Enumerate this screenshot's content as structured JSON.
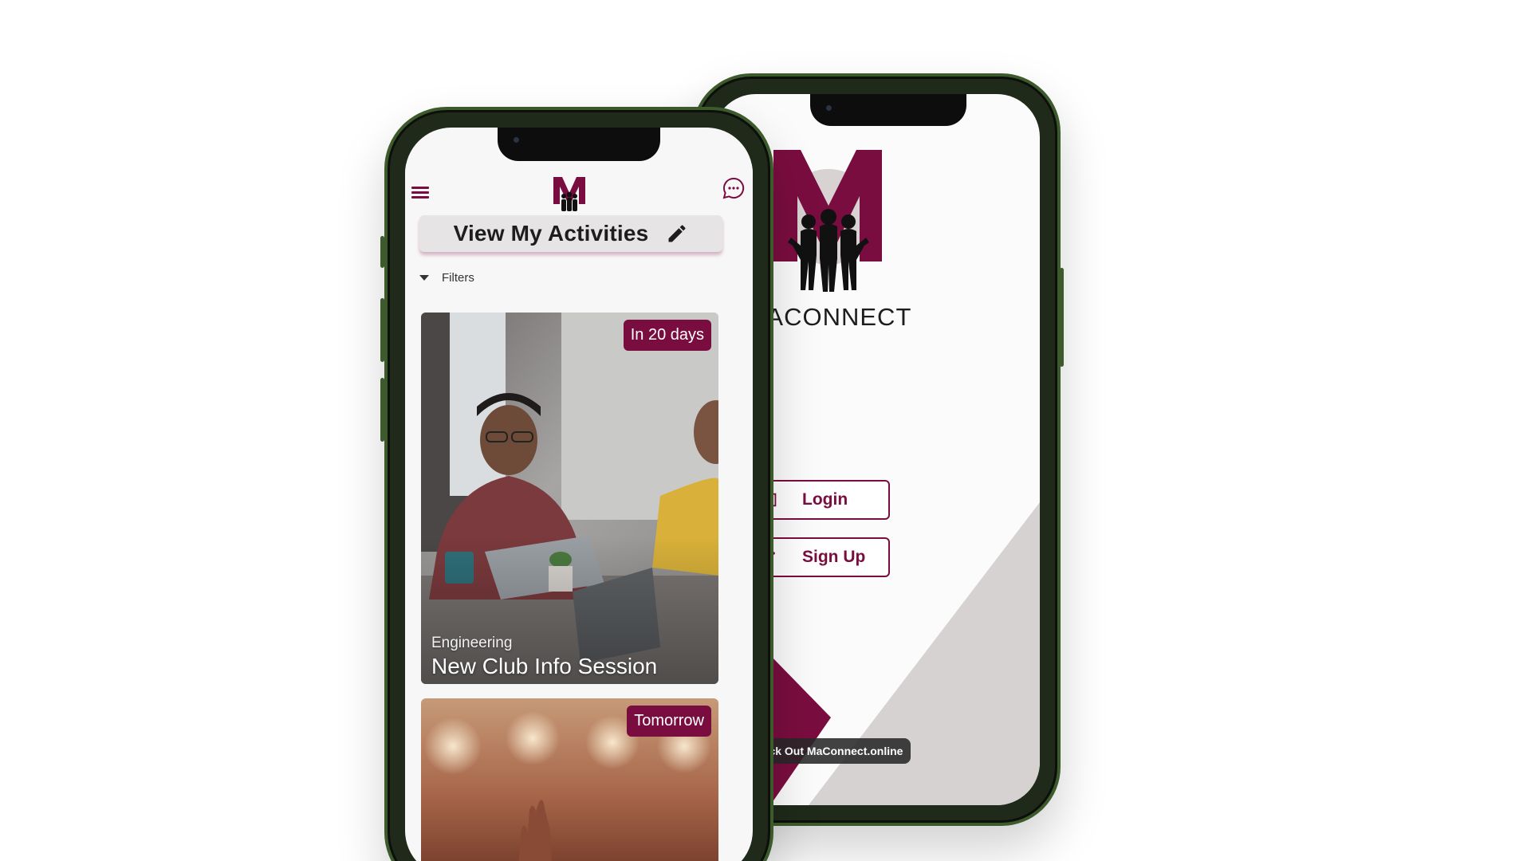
{
  "login_screen": {
    "brand_name": "MACONNECT",
    "login_label": "Login",
    "signup_label": "Sign Up",
    "promo_chip": "Check Out MaConnect.online"
  },
  "activities_screen": {
    "title": "View My Activities",
    "filters_label": "Filters",
    "cards": [
      {
        "badge": "In 20 days",
        "category": "Engineering",
        "title": "New Club Info Session"
      },
      {
        "badge": "Tomorrow"
      }
    ]
  },
  "colors": {
    "brand": "#7a0d3f",
    "accent_gray": "#d7d2d2",
    "phone_frame": "#3d5a2c"
  },
  "icons": [
    "menu-icon",
    "chat-bubble-icon",
    "edit-pencil-icon",
    "login-arrow-icon",
    "signup-grid-icon",
    "caret-down-icon"
  ]
}
